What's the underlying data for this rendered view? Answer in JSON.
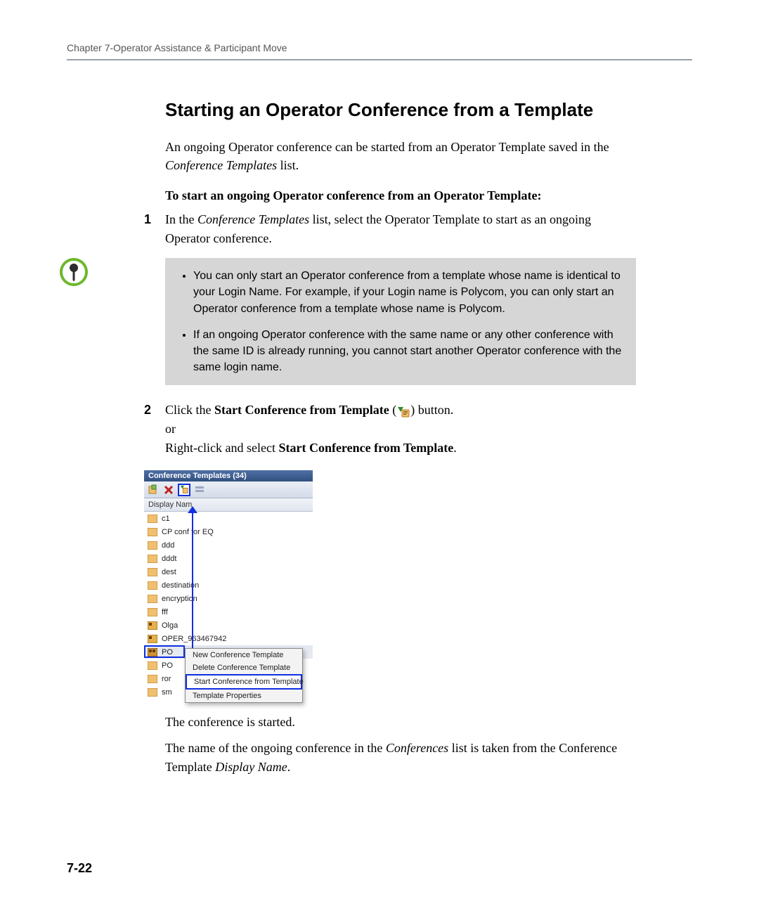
{
  "header": "Chapter 7-Operator Assistance & Participant Move",
  "title": "Starting an Operator Conference from a Template",
  "intro_a": "An ongoing Operator conference can be started from an Operator Template saved in the ",
  "intro_b_italic": "Conference Templates",
  "intro_c": " list.",
  "subhead": "To start an ongoing Operator conference from an Operator Template:",
  "step1": {
    "num": "1",
    "a": "In the ",
    "b": "Conference Templates",
    "c": " list, select the Operator Template to start as an ongoing Operator conference."
  },
  "note": {
    "b1": "You can only start an Operator conference from a template whose name is identical to your Login Name. For example, if your Login name is Polycom, you can only start an Operator conference from a template whose name is Polycom.",
    "b2": "If an ongoing Operator conference with the same name or any other conference with the same ID is already running, you cannot start another Operator conference with the same login name."
  },
  "step2": {
    "num": "2",
    "a": "Click the ",
    "b": "Start Conference from Template",
    "c": " (",
    "d": ") button.",
    "e": "or",
    "f": "Right-click and select ",
    "g": "Start Conference from Template",
    "h": "."
  },
  "shot": {
    "title": "Conference Templates (34)",
    "colhead": "Display Nam",
    "rows": [
      "c1",
      "CP conf for EQ",
      "ddd",
      "dddt",
      "dest",
      "destination",
      "encryption",
      "fff",
      "Olga",
      "OPER_963467942",
      "PO",
      "PO",
      "ror",
      "sm"
    ],
    "menu": [
      "New Conference Template",
      "Delete Conference Template",
      "Start Conference from Template",
      "Template Properties"
    ]
  },
  "after1": "The conference is started.",
  "after2_a": "The name of the ongoing conference in the ",
  "after2_b": "Conferences",
  "after2_c": " list is taken from the Conference Template ",
  "after2_d": "Display Name",
  "after2_e": ".",
  "pagenum": "7-22",
  "icons": {
    "start_green_arrow": "#2e8b2e",
    "template_orange": "#d67a1d"
  }
}
